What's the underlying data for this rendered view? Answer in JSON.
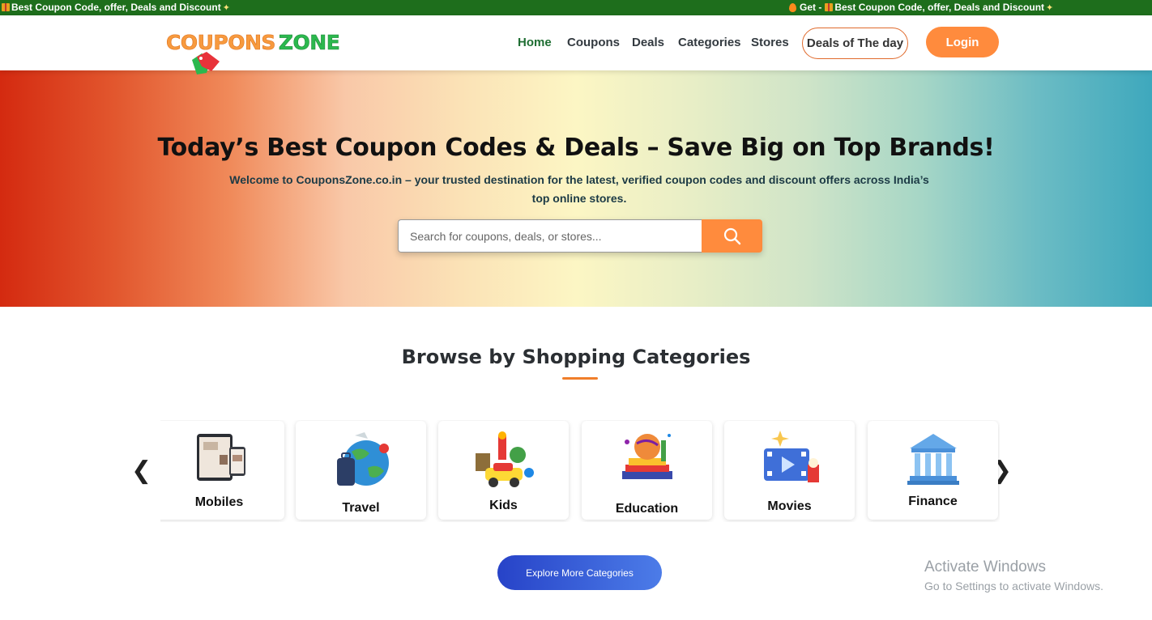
{
  "ticker": {
    "left_text": "Best Coupon Code, offer, Deals and Discount",
    "right_prefix": "Get -",
    "right_text": "Best Coupon Code, offer, Deals and Discount"
  },
  "header": {
    "logo_word1": "COUPONS",
    "logo_word2": "ZONE",
    "nav": [
      "Home",
      "Coupons",
      "Deals",
      "Categories",
      "Stores"
    ],
    "deals_button": "Deals of The day",
    "login_button": "Login"
  },
  "hero": {
    "title": "Today’s Best Coupon Codes & Deals – Save Big on Top Brands!",
    "subtitle": "Welcome to CouponsZone.co.in – your trusted destination for the latest, verified coupon codes and discount offers across India’s top online stores.",
    "search_placeholder": "Search for coupons, deals, or stores..."
  },
  "categories": {
    "title": "Browse by Shopping Categories",
    "prev_arrow": "❮",
    "next_arrow": "❯",
    "items": [
      "Mobiles",
      "Travel",
      "Kids",
      "Education",
      "Movies",
      "Finance"
    ],
    "explore_button": "Explore More Categories"
  },
  "watermark": {
    "line1": "Activate Windows",
    "line2": "Go to Settings to activate Windows."
  },
  "colors": {
    "ticker_bg": "#1e6e1c",
    "accent_orange": "#ff8b3d",
    "nav_active": "#1f6e33",
    "explore_blue": "#2743c8"
  }
}
